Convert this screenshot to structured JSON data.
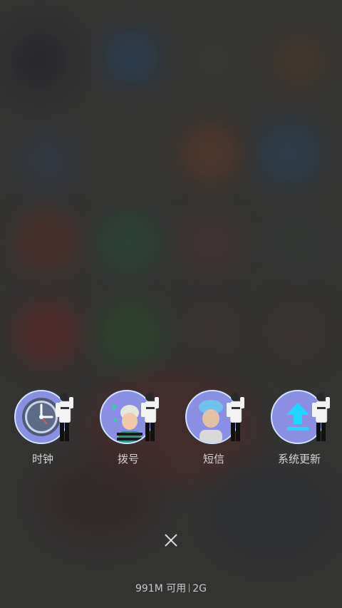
{
  "apps": [
    {
      "label": "时钟",
      "icon": "clock-icon"
    },
    {
      "label": "拨号",
      "icon": "contact-photo-icon"
    },
    {
      "label": "短信",
      "icon": "contact-photo-icon"
    },
    {
      "label": "系统更新",
      "icon": "upload-arrow-icon"
    }
  ],
  "close_icon": "close-icon",
  "memory": {
    "available": "991M 可用",
    "total": "2G"
  },
  "colors": {
    "circle": "#8b8fe3",
    "upload_arrow": "#1fd6ff"
  }
}
